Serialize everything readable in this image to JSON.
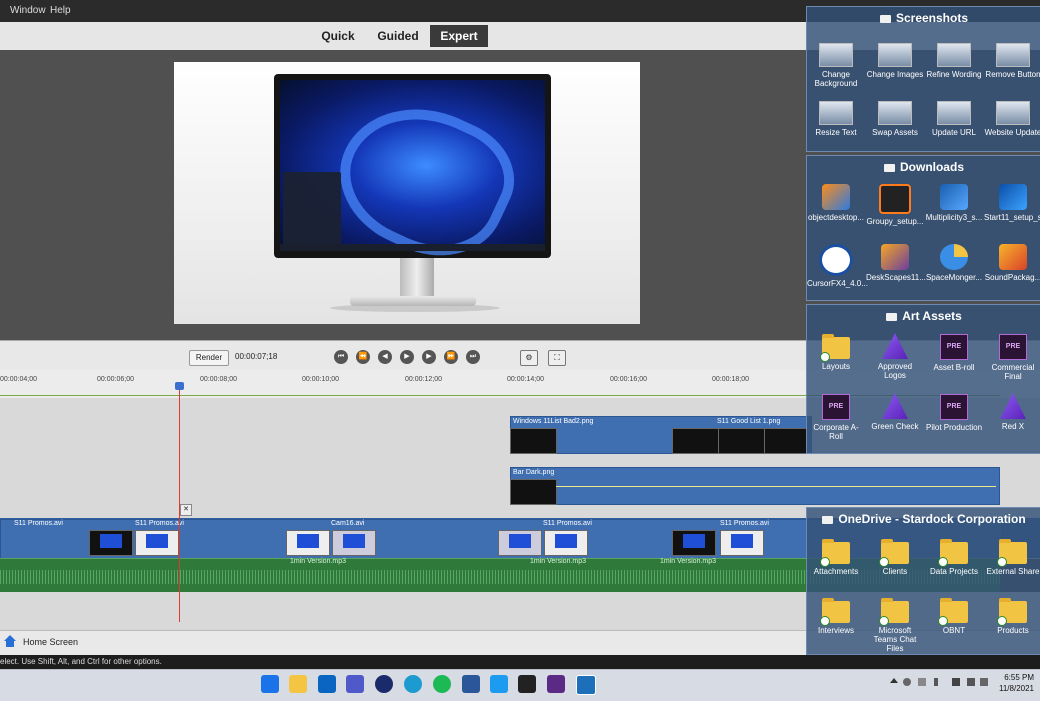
{
  "menu": {
    "window": "Window",
    "help": "Help"
  },
  "modes": {
    "quick": "Quick",
    "guided": "Guided",
    "expert": "Expert"
  },
  "controls": {
    "render": "Render",
    "timecode": "00:00:07;18"
  },
  "ruler": [
    "00:00:04;00",
    "00:00:06;00",
    "00:00:08;00",
    "00:00:10;00",
    "00:00:12;00",
    "00:00:14;00",
    "00:00:16;00",
    "00:00:18;00"
  ],
  "clips": {
    "track1": [
      "Windows 11List Bad2.png",
      "S11 Good List 1.png"
    ],
    "track2": [
      "Bar Dark.png"
    ],
    "video": [
      "S11 Promos.avi",
      "S11 Promos.avi",
      "Cam16.avi",
      "S11 Promos.avi",
      "S11 Promos.avi"
    ],
    "audio": [
      "1min Version.mp3",
      "1min Version.mp3",
      "1min Version.mp3"
    ]
  },
  "home": {
    "label": "Home Screen"
  },
  "status": {
    "text": "elect. Use Shift, Alt, and Ctrl for other options."
  },
  "taskbar": {
    "time": "6:55 PM",
    "date": "11/8/2021"
  },
  "fences": {
    "screenshots": {
      "title": "Screenshots",
      "items": [
        "Change Background",
        "Change Images",
        "Refine Wording",
        "Remove Button",
        "Resize Text",
        "Swap Assets",
        "Update URL",
        "Website Update"
      ]
    },
    "downloads": {
      "title": "Downloads",
      "items": [
        "objectdesktop...",
        "Groupy_setup...",
        "Multiplicity3_s...",
        "Start11_setup_s...",
        "CursorFX4_4.0...",
        "DeskScapes11...",
        "SpaceMonger...",
        "SoundPackag..."
      ]
    },
    "art": {
      "title": "Art Assets",
      "items": [
        "Layouts",
        "Approved Logos",
        "Asset B-roll",
        "Commercial Final",
        "Corporate A-Roll",
        "Green Check",
        "Pilot Production",
        "Red X"
      ],
      "pre_badge": "PRE"
    },
    "onedrive": {
      "title": "OneDrive - Stardock Corporation",
      "items": [
        "Attachments",
        "Clients",
        "Data Projects",
        "External Share",
        "Interviews",
        "Microsoft Teams Chat Files",
        "OBNT",
        "Products"
      ]
    }
  }
}
